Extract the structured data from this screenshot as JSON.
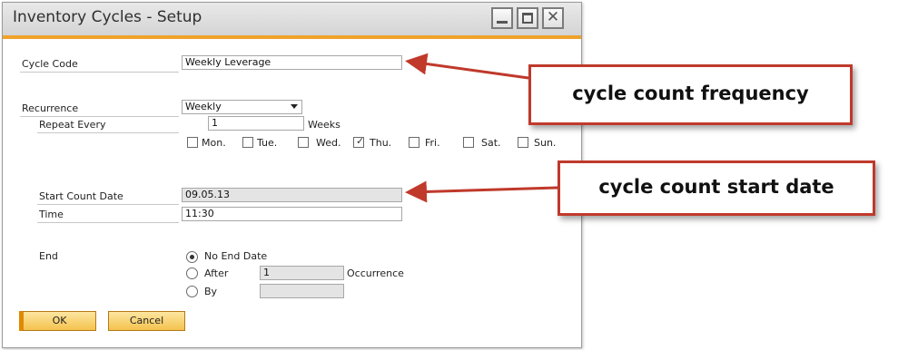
{
  "window": {
    "title": "Inventory Cycles - Setup"
  },
  "form": {
    "cycle_code_label": "Cycle Code",
    "cycle_code_value": "Weekly Leverage",
    "recurrence_label": "Recurrence",
    "recurrence_value": "Weekly",
    "repeat_every_label": "Repeat Every",
    "repeat_every_value": "1",
    "repeat_unit": "Weeks",
    "days": [
      {
        "label": "Mon.",
        "checked": false
      },
      {
        "label": "Tue.",
        "checked": false
      },
      {
        "label": "Wed.",
        "checked": false
      },
      {
        "label": "Thu.",
        "checked": true
      },
      {
        "label": "Fri.",
        "checked": false
      },
      {
        "label": "Sat.",
        "checked": false
      },
      {
        "label": "Sun.",
        "checked": false
      }
    ],
    "start_date_label": "Start Count Date",
    "start_date_value": "09.05.13",
    "time_label": "Time",
    "time_value": "11:30",
    "end_label": "End",
    "end_options": {
      "no_end_date": "No End Date",
      "after": "After",
      "after_value": "1",
      "occurrence": "Occurrence",
      "by": "By",
      "by_value": ""
    },
    "selected_end_option": "No End Date"
  },
  "buttons": {
    "ok": "OK",
    "cancel": "Cancel"
  },
  "callouts": {
    "frequency": "cycle count frequency",
    "start_date": "cycle count start date"
  },
  "colors": {
    "accent": "#f0a22b",
    "callout_border": "#c0392b",
    "arrow": "#c0392b"
  }
}
